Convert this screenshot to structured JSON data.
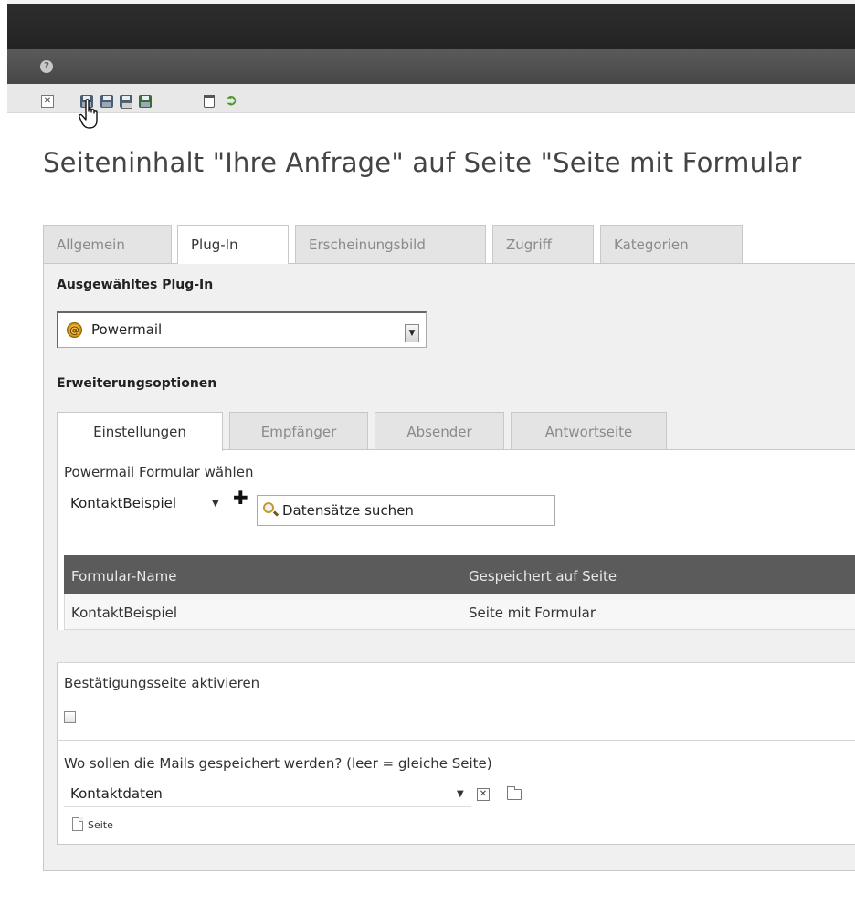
{
  "header": {
    "help_glyph": "?"
  },
  "toolbar": {
    "close_glyph": "✕",
    "icons": [
      "close-icon",
      "save-icon",
      "save-view-icon",
      "save-close-icon",
      "save-new-icon",
      "delete-icon",
      "undo-icon"
    ]
  },
  "page": {
    "title": "Seiteninhalt \"Ihre Anfrage\" auf Seite \"Seite mit Formular"
  },
  "main_tabs": [
    {
      "label": "Allgemein",
      "active": false
    },
    {
      "label": "Plug-In",
      "active": true
    },
    {
      "label": "Erscheinungsbild",
      "active": false
    },
    {
      "label": "Zugriff",
      "active": false
    },
    {
      "label": "Kategorien",
      "active": false
    }
  ],
  "plugin_section": {
    "heading": "Ausgewähltes Plug-In",
    "selected_plugin": "Powermail",
    "plugin_icon_glyph": "@"
  },
  "extension_section": {
    "heading": "Erweiterungsoptionen",
    "tabs": [
      {
        "label": "Einstellungen",
        "active": true
      },
      {
        "label": "Empfänger",
        "active": false
      },
      {
        "label": "Absender",
        "active": false
      },
      {
        "label": "Antwortseite",
        "active": false
      }
    ]
  },
  "form_select": {
    "label": "Powermail Formular wählen",
    "value": "KontaktBeispiel",
    "add_glyph": "✚",
    "search_placeholder": "Datensätze suchen"
  },
  "records_table": {
    "columns": [
      "Formular-Name",
      "Gespeichert auf Seite"
    ],
    "rows": [
      [
        "KontaktBeispiel",
        "Seite mit Formular"
      ]
    ]
  },
  "confirmation": {
    "label": "Bestätigungsseite aktivieren",
    "checked": false
  },
  "storage": {
    "label": "Wo sollen die Mails gespeichert werden? (leer = gleiche Seite)",
    "value": "Kontaktdaten",
    "clear_glyph": "✕",
    "record_type": "Seite"
  },
  "colors": {
    "topbar": "#2a2a2a",
    "subbar": "#505050",
    "table_header": "#5b5b5b",
    "undo_green": "#4a9a22"
  }
}
